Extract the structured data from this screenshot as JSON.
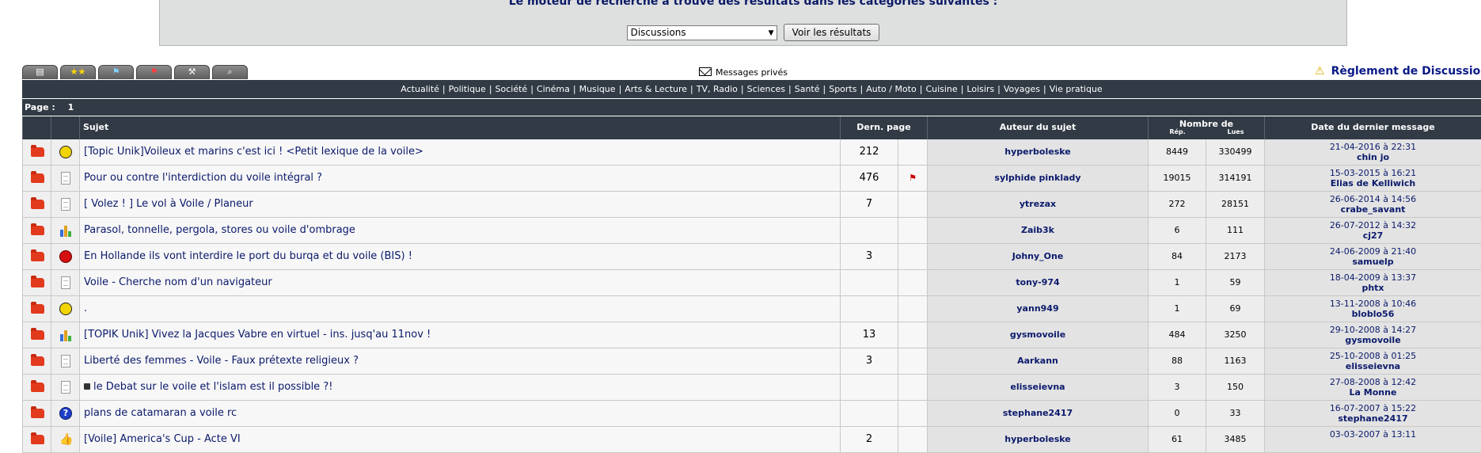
{
  "search": {
    "message": "Le moteur de recherche a trouvé des résultats dans les catégories suivantes :",
    "selected_category": "Discussions",
    "button_label": "Voir les résultats"
  },
  "toolbar": {
    "private_messages": "Messages privés",
    "rules_link": "Règlement de Discussions"
  },
  "categories": [
    "Actualité",
    "Politique",
    "Société",
    "Cinéma",
    "Musique",
    "Arts & Lecture",
    "TV, Radio",
    "Sciences",
    "Santé",
    "Sports",
    "Auto / Moto",
    "Cuisine",
    "Loisirs",
    "Voyages",
    "Vie pratique"
  ],
  "pagination": {
    "label": "Page :",
    "current": "1"
  },
  "table": {
    "headers": {
      "subject": "Sujet",
      "last_page": "Dern. page",
      "author": "Auteur du sujet",
      "count_group": "Nombre de",
      "replies": "Rép.",
      "reads": "Lues",
      "last_message_date": "Date du dernier message"
    },
    "rows": [
      {
        "icon": "smiley-icon",
        "subject": "[Topic Unik]Voileux et marins c'est ici ! <Petit lexique de la voile>",
        "last_page": "212",
        "flag": "",
        "author": "hyperboleske",
        "replies": "8449",
        "reads": "330499",
        "date": "21-04-2016 à 22:31",
        "by": "chin jo"
      },
      {
        "icon": "document-icon",
        "subject": "Pour ou contre l'interdiction du voile intégral ?",
        "last_page": "476",
        "flag": "red-flag",
        "author": "sylphide pinklady",
        "replies": "19015",
        "reads": "314191",
        "date": "15-03-2015 à 16:21",
        "by": "Elias de Kelliwich"
      },
      {
        "icon": "document-icon",
        "subject": "[ Volez ! ] Le vol à Voile / Planeur",
        "last_page": "7",
        "flag": "",
        "author": "ytrezax",
        "replies": "272",
        "reads": "28151",
        "date": "26-06-2014 à 14:56",
        "by": "crabe_savant"
      },
      {
        "icon": "chart-icon",
        "subject": "Parasol, tonnelle, pergola, stores ou voile d'ombrage",
        "last_page": "",
        "flag": "",
        "author": "Zaib3k",
        "replies": "6",
        "reads": "111",
        "date": "26-07-2012 à 14:32",
        "by": "cj27"
      },
      {
        "icon": "red-circle-icon",
        "subject": "En Hollande ils vont interdire le port du burqa et du voile (BIS) !",
        "last_page": "3",
        "flag": "",
        "author": "Johny_One",
        "replies": "84",
        "reads": "2173",
        "date": "24-06-2009 à 21:40",
        "by": "samuelp"
      },
      {
        "icon": "document-icon",
        "subject": "Voile - Cherche nom d'un navigateur",
        "last_page": "",
        "flag": "",
        "author": "tony-974",
        "replies": "1",
        "reads": "59",
        "date": "18-04-2009 à 13:37",
        "by": "phtx"
      },
      {
        "icon": "smiley-icon",
        "subject": ".",
        "last_page": "",
        "flag": "",
        "author": "yann949",
        "replies": "1",
        "reads": "69",
        "date": "13-11-2008 à 10:46",
        "by": "bloblo56"
      },
      {
        "icon": "chart-icon",
        "subject": "[TOPIK Unik] Vivez la Jacques Vabre en virtuel - ins. jusq'au 11nov !",
        "last_page": "13",
        "flag": "",
        "author": "gysmovoile",
        "replies": "484",
        "reads": "3250",
        "date": "29-10-2008 à 14:27",
        "by": "gysmovoile"
      },
      {
        "icon": "document-icon",
        "subject": "Liberté des femmes - Voile - Faux prétexte religieux ?",
        "last_page": "3",
        "flag": "",
        "author": "Aarkann",
        "replies": "88",
        "reads": "1163",
        "date": "25-10-2008 à 01:25",
        "by": "elisseievna"
      },
      {
        "icon": "document-icon",
        "subject": "le Debat sur le voile et l'islam est il possible ?!",
        "locked": true,
        "last_page": "",
        "flag": "",
        "author": "elisseievna",
        "replies": "3",
        "reads": "150",
        "date": "27-08-2008 à 12:42",
        "by": "La Monne"
      },
      {
        "icon": "question-icon",
        "subject": "plans de catamaran a voile rc",
        "last_page": "",
        "flag": "",
        "author": "stephane2417",
        "replies": "0",
        "reads": "33",
        "date": "16-07-2007 à 15:22",
        "by": "stephane2417"
      },
      {
        "icon": "thumb-icon",
        "subject": "[Voile] America's Cup - Acte VI",
        "last_page": "2",
        "flag": "",
        "author": "hyperboleske",
        "replies": "61",
        "reads": "3485",
        "date": "03-03-2007 à 13:11",
        "by": ""
      }
    ]
  }
}
